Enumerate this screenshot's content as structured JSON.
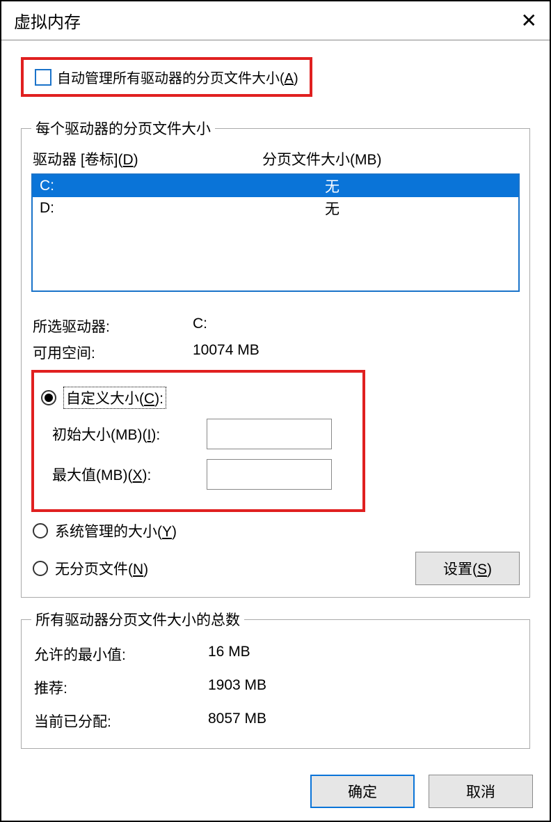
{
  "window": {
    "title": "虚拟内存"
  },
  "auto_manage": {
    "label_prefix": "自动管理所有驱动器的分页文件大小(",
    "accel": "A",
    "label_suffix": ")"
  },
  "drives_group": {
    "legend": "每个驱动器的分页文件大小",
    "header_drive_prefix": "驱动器 [卷标](",
    "header_drive_accel": "D",
    "header_drive_suffix": ")",
    "header_size": "分页文件大小(MB)",
    "rows": [
      {
        "drive": "C:",
        "size": "无",
        "selected": true
      },
      {
        "drive": "D:",
        "size": "无",
        "selected": false
      }
    ]
  },
  "selected_info": {
    "drive_label": "所选驱动器:",
    "drive_value": "C:",
    "free_label": "可用空间:",
    "free_value": "10074 MB"
  },
  "size_opts": {
    "custom_prefix": "自定义大小(",
    "custom_accel": "C",
    "custom_suffix": "):",
    "initial_prefix": "初始大小(MB)(",
    "initial_accel": "I",
    "initial_suffix": "):",
    "max_prefix": "最大值(MB)(",
    "max_accel": "X",
    "max_suffix": "):",
    "system_prefix": "系统管理的大小(",
    "system_accel": "Y",
    "system_suffix": ")",
    "none_prefix": "无分页文件(",
    "none_accel": "N",
    "none_suffix": ")",
    "set_btn_prefix": "设置(",
    "set_btn_accel": "S",
    "set_btn_suffix": ")"
  },
  "totals_group": {
    "legend": "所有驱动器分页文件大小的总数",
    "min_label": "允许的最小值:",
    "min_value": "16 MB",
    "rec_label": "推荐:",
    "rec_value": "1903 MB",
    "cur_label": "当前已分配:",
    "cur_value": "8057 MB"
  },
  "footer": {
    "ok": "确定",
    "cancel": "取消"
  }
}
